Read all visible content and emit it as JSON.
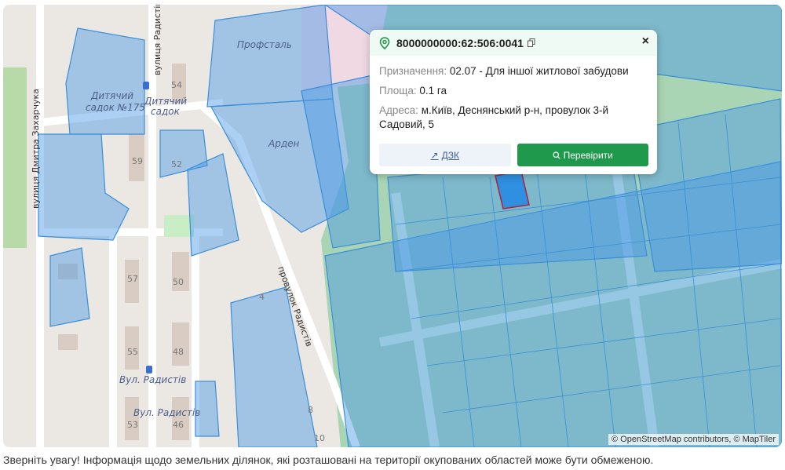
{
  "map": {
    "labels": {
      "street_zakharchuka": "вулиця Дмитра Захарчука",
      "street_radystiv": "вулиця Радистів",
      "kindergarten": "Дитячий садок №175",
      "kindergarten_l1": "Дитячий",
      "kindergarten_l2": "садок №175",
      "stop_l1": "Дитячий",
      "stop_l2": "садок",
      "profstal": "Профсталь",
      "arden": "Арден",
      "lane_radystiv": "провулок Радистів",
      "stop_radystiv_1": "Вул. Радистів",
      "stop_radystiv_2": "Вул. Радистів"
    },
    "house_numbers": [
      "54",
      "59",
      "52",
      "57",
      "50",
      "55",
      "48",
      "53",
      "46",
      "4",
      "8",
      "10"
    ],
    "attribution": "© OpenStreetMap contributors, © MapTiler"
  },
  "popup": {
    "cadastral_number": "8000000000:62:506:0041",
    "purpose_label": "Призначення:",
    "purpose_value": "02.07 - Для іншої житлової забудови",
    "area_label": "Площа:",
    "area_value": "0.1 га",
    "address_label": "Адреса:",
    "address_value": "м.Київ, Деснянський р-н, провулок 3-й Садовий, 5",
    "dzk_button": "ДЗК",
    "check_button": "Перевірити",
    "close": "×"
  },
  "notice": "Зверніть увагу! Інформація щодо земельних ділянок, які розташовані на території окупованих областей може бути обмеженою.",
  "colors": {
    "accent": "#1f9a4c",
    "parcel": "#3a8fd8"
  }
}
